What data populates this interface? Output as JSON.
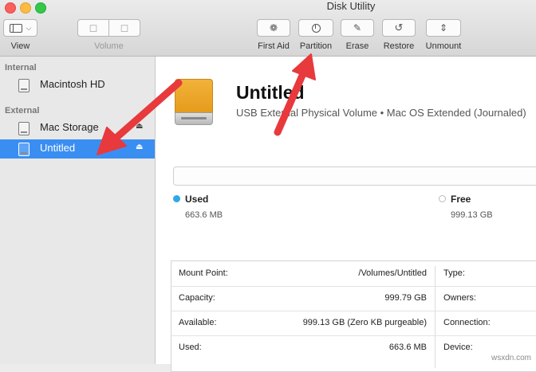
{
  "window": {
    "title": "Disk Utility"
  },
  "toolbar": {
    "view_label": "View",
    "volume_label": "Volume",
    "first_aid_label": "First Aid",
    "partition_label": "Partition",
    "erase_label": "Erase",
    "restore_label": "Restore",
    "unmount_label": "Unmount"
  },
  "sidebar": {
    "internal_header": "Internal",
    "external_header": "External",
    "items": [
      {
        "label": "Macintosh HD"
      },
      {
        "label": "Mac Storage"
      },
      {
        "label": "Untitled"
      }
    ],
    "selected_color": "#3a8ef2"
  },
  "volume": {
    "title": "Untitled",
    "subtitle": "USB External Physical Volume • Mac OS Extended (Journaled)"
  },
  "usage": {
    "used_label": "Used",
    "used_value": "663.6 MB",
    "used_color": "#2ea8e6",
    "free_label": "Free",
    "free_value": "999.13 GB"
  },
  "info": {
    "rows": [
      {
        "key": "Mount Point:",
        "value": "/Volumes/Untitled",
        "key2": "Type:"
      },
      {
        "key": "Capacity:",
        "value": "999.79 GB",
        "key2": "Owners:"
      },
      {
        "key": "Available:",
        "value": "999.13 GB (Zero KB purgeable)",
        "key2": "Connection:"
      },
      {
        "key": "Used:",
        "value": "663.6 MB",
        "key2": "Device:"
      }
    ]
  },
  "annotation": {
    "arrow_color": "#e8393c"
  },
  "watermark": "wsxdn.com"
}
